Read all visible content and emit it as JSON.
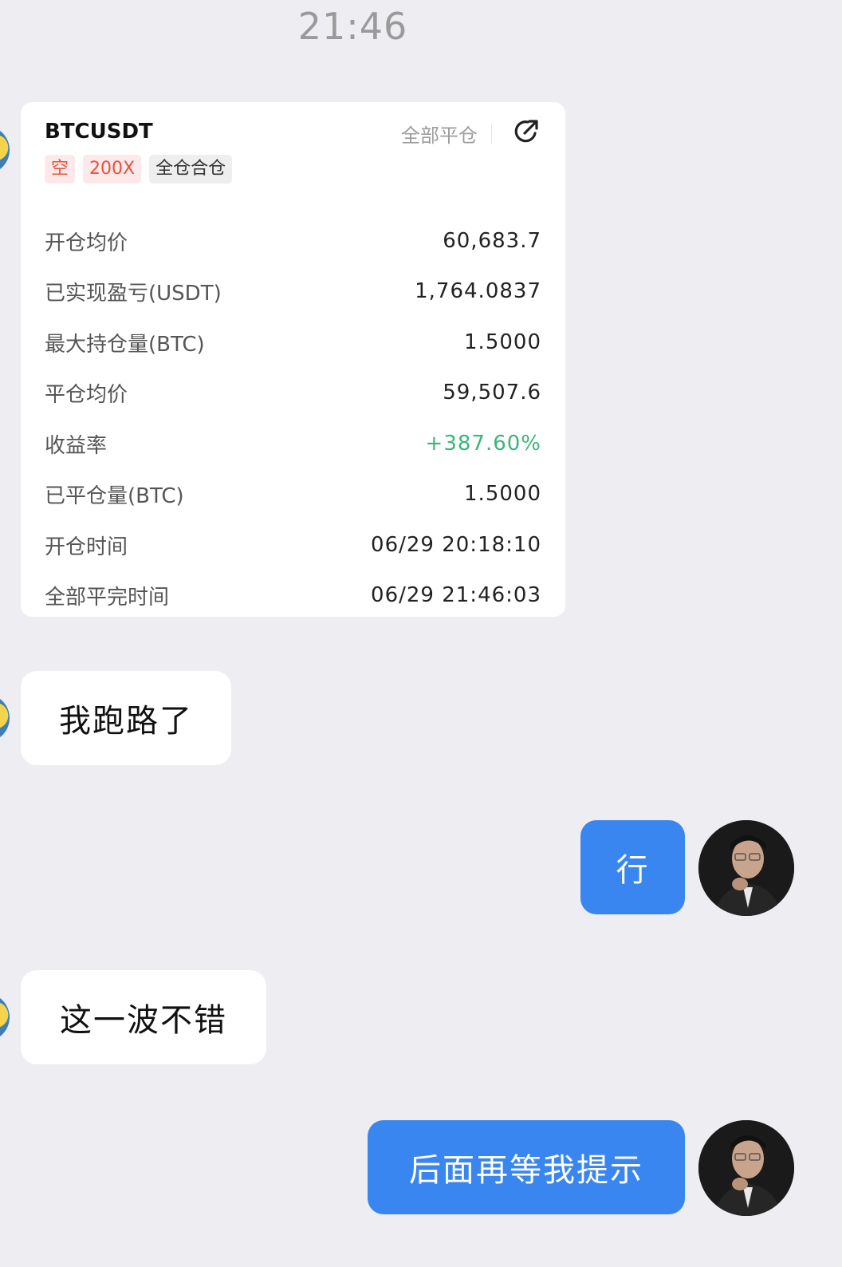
{
  "header": {
    "time": "21:46"
  },
  "card": {
    "symbol": "BTCUSDT",
    "tags": [
      "空",
      "200X",
      "全仓合仓"
    ],
    "close_all": "全部平仓",
    "share_icon": "share-arrow-icon",
    "rows": [
      {
        "label": "开仓均价",
        "value": "60,683.7"
      },
      {
        "label": "已实现盈亏(USDT)",
        "value": "1,764.0837"
      },
      {
        "label": "最大持仓量(BTC)",
        "value": "1.5000"
      },
      {
        "label": "平仓均价",
        "value": "59,507.6"
      },
      {
        "label": "收益率",
        "value": "+387.60%"
      },
      {
        "label": "已平仓量(BTC)",
        "value": "1.5000"
      },
      {
        "label": "开仓时间",
        "value": "06/29 20:18:10"
      },
      {
        "label": "全部平完时间",
        "value": "06/29 21:46:03"
      }
    ]
  },
  "messages": [
    {
      "side": "in",
      "text": "我跑路了"
    },
    {
      "side": "out",
      "text": "行"
    },
    {
      "side": "in",
      "text": "这一波不错"
    },
    {
      "side": "out",
      "text": "后面再等我提示"
    }
  ],
  "colors": {
    "background": "#ededf2",
    "outgoing_bubble": "#3a86f0",
    "profit_green": "#3db47b",
    "short_red": "#e5533e"
  }
}
